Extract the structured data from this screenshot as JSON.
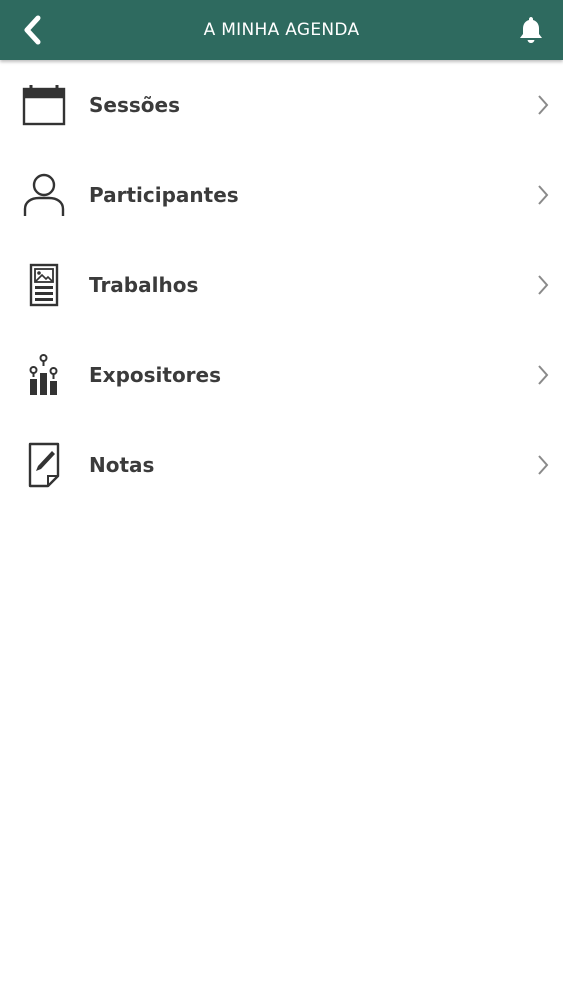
{
  "header": {
    "title": "A MINHA AGENDA",
    "back_icon": "chevron-left-icon",
    "bell_icon": "bell-icon",
    "bg_color": "#2e6a5f"
  },
  "menu": {
    "items": [
      {
        "label": "Sessões",
        "icon": "calendar-icon"
      },
      {
        "label": "Participantes",
        "icon": "user-icon"
      },
      {
        "label": "Trabalhos",
        "icon": "poster-icon"
      },
      {
        "label": "Expositores",
        "icon": "exhibitors-icon"
      },
      {
        "label": "Notas",
        "icon": "note-icon"
      }
    ]
  }
}
